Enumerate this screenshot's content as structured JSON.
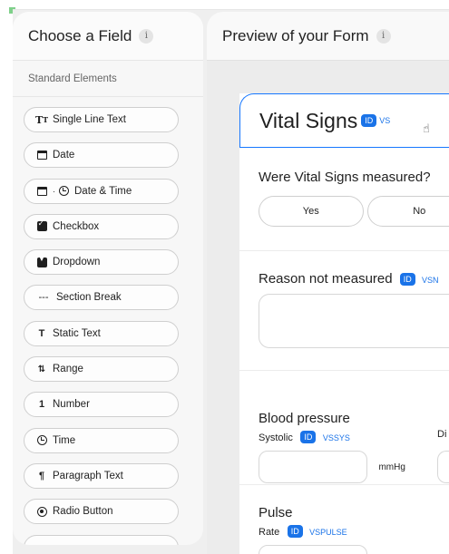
{
  "left_panel": {
    "title": "Choose a Field",
    "info": "i",
    "section": "Standard Elements",
    "items": [
      {
        "label": "Single Line Text",
        "icon": "text-tt-icon",
        "glyph": "Tт"
      },
      {
        "label": "Date",
        "icon": "calendar-icon"
      },
      {
        "label": "Date & Time",
        "icon": "calendar-clock-icon"
      },
      {
        "label": "Checkbox",
        "icon": "checkbox-icon"
      },
      {
        "label": "Dropdown",
        "icon": "dropdown-icon"
      },
      {
        "label": "Section Break",
        "icon": "section-break-icon",
        "glyph": "---"
      },
      {
        "label": "Static Text",
        "icon": "static-text-icon",
        "glyph": "T"
      },
      {
        "label": "Range",
        "icon": "range-icon",
        "glyph": "↑↓"
      },
      {
        "label": "Number",
        "icon": "number-icon",
        "glyph": "1"
      },
      {
        "label": "Time",
        "icon": "clock-icon"
      },
      {
        "label": "Paragraph Text",
        "icon": "paragraph-icon",
        "glyph": "¶"
      },
      {
        "label": "Radio Button",
        "icon": "radio-icon"
      }
    ]
  },
  "right_panel": {
    "title": "Preview of your Form",
    "info": "i"
  },
  "form": {
    "title": "Vital Signs",
    "id_badge": "ID",
    "id_code": "VS",
    "q1": {
      "title": "Were Vital Signs measured?",
      "yes": "Yes",
      "no": "No"
    },
    "q2": {
      "title": "Reason not measured",
      "id_badge": "ID",
      "id_code": "VSN"
    },
    "bp": {
      "title": "Blood pressure",
      "systolic_label": "Systolic",
      "id_badge": "ID",
      "id_code": "VSSYS",
      "unit": "mmHg",
      "diastolic_partial": "Di"
    },
    "pulse": {
      "title": "Pulse",
      "rate_label": "Rate",
      "id_badge": "ID",
      "id_code": "VSPULSE"
    }
  },
  "colors": {
    "accent": "#1a73e8",
    "corner_mark": "#7fd08a"
  }
}
